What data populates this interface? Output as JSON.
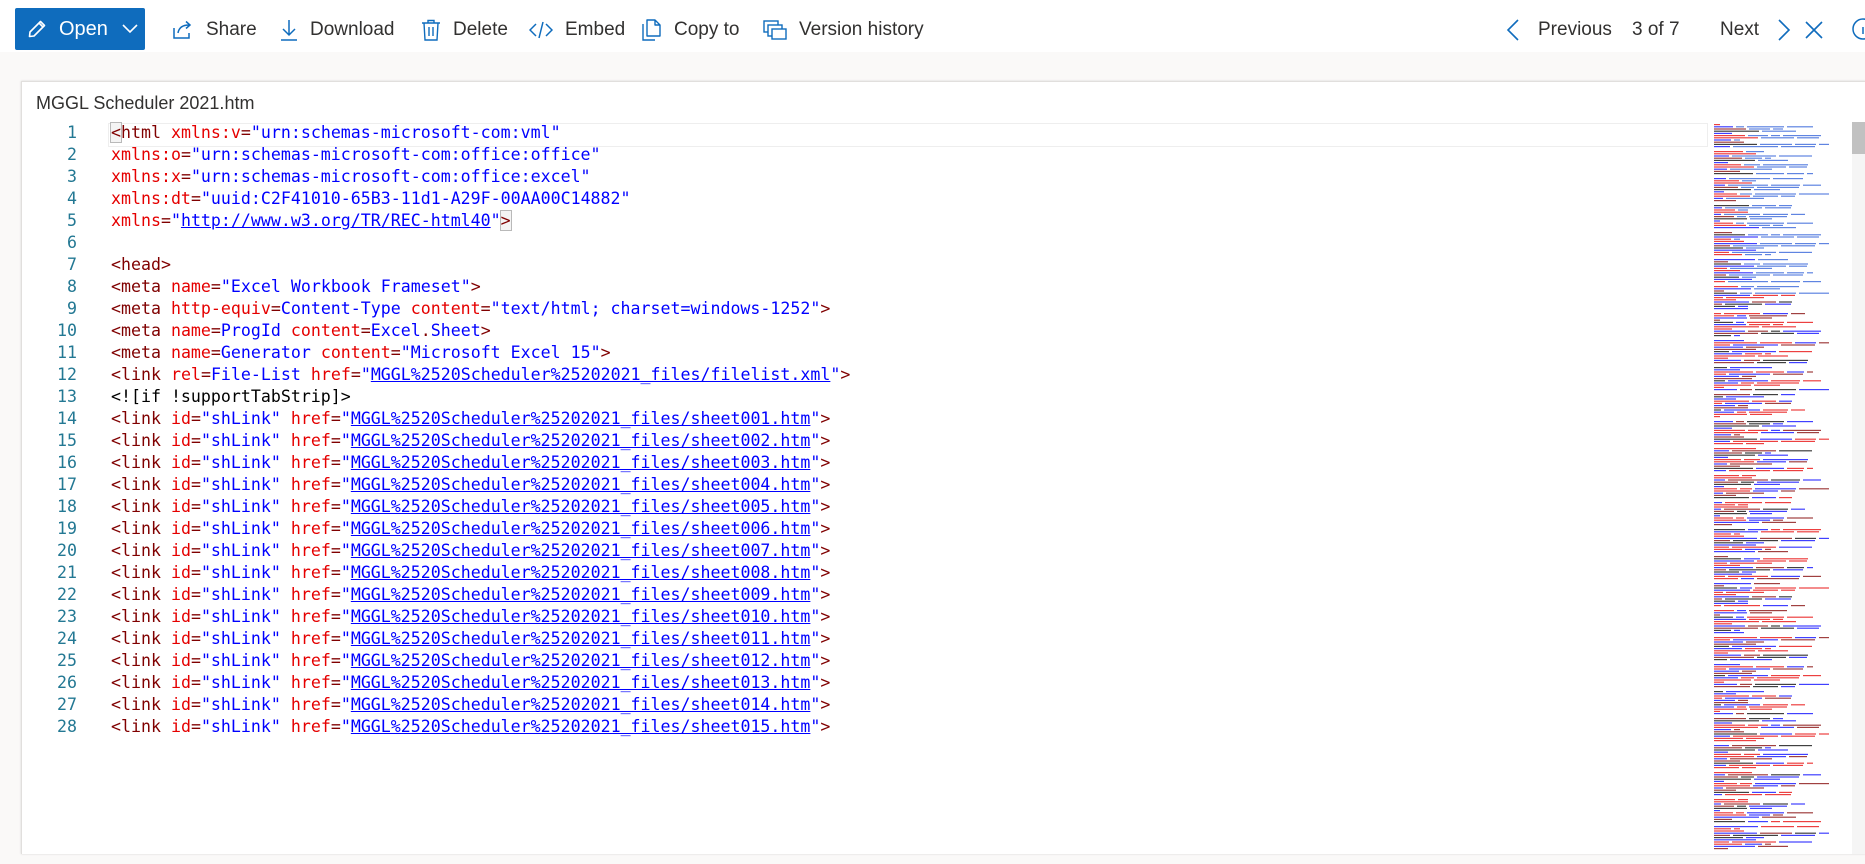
{
  "toolbar": {
    "open_label": "Open",
    "share_label": "Share",
    "download_label": "Download",
    "delete_label": "Delete",
    "embed_label": "Embed",
    "copyto_label": "Copy to",
    "version_label": "Version history",
    "previous_label": "Previous",
    "counter": "3 of 7",
    "next_label": "Next",
    "accent": "#0f6cbd",
    "icons": [
      "pencil-icon",
      "chevron-down-icon",
      "share-icon",
      "download-icon",
      "delete-icon",
      "embed-icon",
      "copy-icon",
      "version-history-icon",
      "chevron-left-icon",
      "chevron-right-icon",
      "close-icon",
      "info-icon"
    ]
  },
  "viewer": {
    "file_title": "MGGL Scheduler 2021.htm",
    "lines": [
      {
        "n": "1",
        "tokens": [
          [
            "h",
            "<"
          ],
          [
            "tag",
            "html "
          ],
          [
            "attr",
            "xmlns:v"
          ],
          [
            "tag",
            "="
          ],
          [
            "val",
            "\"urn:schemas-microsoft-com:vml\""
          ]
        ]
      },
      {
        "n": "2",
        "tokens": [
          [
            "attr",
            "xmlns:o"
          ],
          [
            "tag",
            "="
          ],
          [
            "val",
            "\"urn:schemas-microsoft-com:office:office\""
          ]
        ]
      },
      {
        "n": "3",
        "tokens": [
          [
            "attr",
            "xmlns:x"
          ],
          [
            "tag",
            "="
          ],
          [
            "val",
            "\"urn:schemas-microsoft-com:office:excel\""
          ]
        ]
      },
      {
        "n": "4",
        "tokens": [
          [
            "attr",
            "xmlns:dt"
          ],
          [
            "tag",
            "="
          ],
          [
            "val",
            "\"uuid:C2F41010-65B3-11d1-A29F-00AA00C14882\""
          ]
        ]
      },
      {
        "n": "5",
        "tokens": [
          [
            "attr",
            "xmlns"
          ],
          [
            "tag",
            "="
          ],
          [
            "val",
            "\""
          ],
          [
            "link",
            "http://www.w3.org/TR/REC-html40"
          ],
          [
            "val",
            "\""
          ],
          [
            "h",
            ">"
          ]
        ]
      },
      {
        "n": "6",
        "tokens": []
      },
      {
        "n": "7",
        "tokens": [
          [
            "tag",
            "<head>"
          ]
        ]
      },
      {
        "n": "8",
        "tokens": [
          [
            "tag",
            "<meta "
          ],
          [
            "attr",
            "name"
          ],
          [
            "tag",
            "="
          ],
          [
            "val",
            "\"Excel Workbook Frameset\""
          ],
          [
            "tag",
            ">"
          ]
        ]
      },
      {
        "n": "9",
        "tokens": [
          [
            "tag",
            "<meta "
          ],
          [
            "attr",
            "http-equiv"
          ],
          [
            "tag",
            "="
          ],
          [
            "val",
            "Content-Type "
          ],
          [
            "attr",
            "content"
          ],
          [
            "tag",
            "="
          ],
          [
            "val",
            "\"text/html; charset=windows-1252\""
          ],
          [
            "tag",
            ">"
          ]
        ]
      },
      {
        "n": "10",
        "tokens": [
          [
            "tag",
            "<meta "
          ],
          [
            "attr",
            "name"
          ],
          [
            "tag",
            "="
          ],
          [
            "val",
            "ProgId "
          ],
          [
            "attr",
            "content"
          ],
          [
            "tag",
            "="
          ],
          [
            "val",
            "Excel"
          ],
          [
            "tag",
            "."
          ],
          [
            "val",
            "Sheet"
          ],
          [
            "tag",
            ">"
          ]
        ]
      },
      {
        "n": "11",
        "tokens": [
          [
            "tag",
            "<meta "
          ],
          [
            "attr",
            "name"
          ],
          [
            "tag",
            "="
          ],
          [
            "val",
            "Generator "
          ],
          [
            "attr",
            "content"
          ],
          [
            "tag",
            "="
          ],
          [
            "val",
            "\"Microsoft Excel 15\""
          ],
          [
            "tag",
            ">"
          ]
        ]
      },
      {
        "n": "12",
        "tokens": [
          [
            "tag",
            "<link "
          ],
          [
            "attr",
            "rel"
          ],
          [
            "tag",
            "="
          ],
          [
            "val",
            "File-List "
          ],
          [
            "attr",
            "href"
          ],
          [
            "tag",
            "="
          ],
          [
            "val",
            "\""
          ],
          [
            "link",
            "MGGL%2520Scheduler%25202021_files/filelist.xml"
          ],
          [
            "val",
            "\""
          ],
          [
            "tag",
            ">"
          ]
        ]
      },
      {
        "n": "13",
        "tokens": [
          [
            "plain",
            "<![if !supportTabStrip]>"
          ]
        ]
      },
      {
        "n": "14",
        "tokens": [
          [
            "tag",
            "<link "
          ],
          [
            "attr",
            "id"
          ],
          [
            "tag",
            "="
          ],
          [
            "val",
            "\"shLink\" "
          ],
          [
            "attr",
            "href"
          ],
          [
            "tag",
            "="
          ],
          [
            "val",
            "\""
          ],
          [
            "link",
            "MGGL%2520Scheduler%25202021_files/sheet001.htm"
          ],
          [
            "val",
            "\""
          ],
          [
            "tag",
            ">"
          ]
        ]
      },
      {
        "n": "15",
        "tokens": [
          [
            "tag",
            "<link "
          ],
          [
            "attr",
            "id"
          ],
          [
            "tag",
            "="
          ],
          [
            "val",
            "\"shLink\" "
          ],
          [
            "attr",
            "href"
          ],
          [
            "tag",
            "="
          ],
          [
            "val",
            "\""
          ],
          [
            "link",
            "MGGL%2520Scheduler%25202021_files/sheet002.htm"
          ],
          [
            "val",
            "\""
          ],
          [
            "tag",
            ">"
          ]
        ]
      },
      {
        "n": "16",
        "tokens": [
          [
            "tag",
            "<link "
          ],
          [
            "attr",
            "id"
          ],
          [
            "tag",
            "="
          ],
          [
            "val",
            "\"shLink\" "
          ],
          [
            "attr",
            "href"
          ],
          [
            "tag",
            "="
          ],
          [
            "val",
            "\""
          ],
          [
            "link",
            "MGGL%2520Scheduler%25202021_files/sheet003.htm"
          ],
          [
            "val",
            "\""
          ],
          [
            "tag",
            ">"
          ]
        ]
      },
      {
        "n": "17",
        "tokens": [
          [
            "tag",
            "<link "
          ],
          [
            "attr",
            "id"
          ],
          [
            "tag",
            "="
          ],
          [
            "val",
            "\"shLink\" "
          ],
          [
            "attr",
            "href"
          ],
          [
            "tag",
            "="
          ],
          [
            "val",
            "\""
          ],
          [
            "link",
            "MGGL%2520Scheduler%25202021_files/sheet004.htm"
          ],
          [
            "val",
            "\""
          ],
          [
            "tag",
            ">"
          ]
        ]
      },
      {
        "n": "18",
        "tokens": [
          [
            "tag",
            "<link "
          ],
          [
            "attr",
            "id"
          ],
          [
            "tag",
            "="
          ],
          [
            "val",
            "\"shLink\" "
          ],
          [
            "attr",
            "href"
          ],
          [
            "tag",
            "="
          ],
          [
            "val",
            "\""
          ],
          [
            "link",
            "MGGL%2520Scheduler%25202021_files/sheet005.htm"
          ],
          [
            "val",
            "\""
          ],
          [
            "tag",
            ">"
          ]
        ]
      },
      {
        "n": "19",
        "tokens": [
          [
            "tag",
            "<link "
          ],
          [
            "attr",
            "id"
          ],
          [
            "tag",
            "="
          ],
          [
            "val",
            "\"shLink\" "
          ],
          [
            "attr",
            "href"
          ],
          [
            "tag",
            "="
          ],
          [
            "val",
            "\""
          ],
          [
            "link",
            "MGGL%2520Scheduler%25202021_files/sheet006.htm"
          ],
          [
            "val",
            "\""
          ],
          [
            "tag",
            ">"
          ]
        ]
      },
      {
        "n": "20",
        "tokens": [
          [
            "tag",
            "<link "
          ],
          [
            "attr",
            "id"
          ],
          [
            "tag",
            "="
          ],
          [
            "val",
            "\"shLink\" "
          ],
          [
            "attr",
            "href"
          ],
          [
            "tag",
            "="
          ],
          [
            "val",
            "\""
          ],
          [
            "link",
            "MGGL%2520Scheduler%25202021_files/sheet007.htm"
          ],
          [
            "val",
            "\""
          ],
          [
            "tag",
            ">"
          ]
        ]
      },
      {
        "n": "21",
        "tokens": [
          [
            "tag",
            "<link "
          ],
          [
            "attr",
            "id"
          ],
          [
            "tag",
            "="
          ],
          [
            "val",
            "\"shLink\" "
          ],
          [
            "attr",
            "href"
          ],
          [
            "tag",
            "="
          ],
          [
            "val",
            "\""
          ],
          [
            "link",
            "MGGL%2520Scheduler%25202021_files/sheet008.htm"
          ],
          [
            "val",
            "\""
          ],
          [
            "tag",
            ">"
          ]
        ]
      },
      {
        "n": "22",
        "tokens": [
          [
            "tag",
            "<link "
          ],
          [
            "attr",
            "id"
          ],
          [
            "tag",
            "="
          ],
          [
            "val",
            "\"shLink\" "
          ],
          [
            "attr",
            "href"
          ],
          [
            "tag",
            "="
          ],
          [
            "val",
            "\""
          ],
          [
            "link",
            "MGGL%2520Scheduler%25202021_files/sheet009.htm"
          ],
          [
            "val",
            "\""
          ],
          [
            "tag",
            ">"
          ]
        ]
      },
      {
        "n": "23",
        "tokens": [
          [
            "tag",
            "<link "
          ],
          [
            "attr",
            "id"
          ],
          [
            "tag",
            "="
          ],
          [
            "val",
            "\"shLink\" "
          ],
          [
            "attr",
            "href"
          ],
          [
            "tag",
            "="
          ],
          [
            "val",
            "\""
          ],
          [
            "link",
            "MGGL%2520Scheduler%25202021_files/sheet010.htm"
          ],
          [
            "val",
            "\""
          ],
          [
            "tag",
            ">"
          ]
        ]
      },
      {
        "n": "24",
        "tokens": [
          [
            "tag",
            "<link "
          ],
          [
            "attr",
            "id"
          ],
          [
            "tag",
            "="
          ],
          [
            "val",
            "\"shLink\" "
          ],
          [
            "attr",
            "href"
          ],
          [
            "tag",
            "="
          ],
          [
            "val",
            "\""
          ],
          [
            "link",
            "MGGL%2520Scheduler%25202021_files/sheet011.htm"
          ],
          [
            "val",
            "\""
          ],
          [
            "tag",
            ">"
          ]
        ]
      },
      {
        "n": "25",
        "tokens": [
          [
            "tag",
            "<link "
          ],
          [
            "attr",
            "id"
          ],
          [
            "tag",
            "="
          ],
          [
            "val",
            "\"shLink\" "
          ],
          [
            "attr",
            "href"
          ],
          [
            "tag",
            "="
          ],
          [
            "val",
            "\""
          ],
          [
            "link",
            "MGGL%2520Scheduler%25202021_files/sheet012.htm"
          ],
          [
            "val",
            "\""
          ],
          [
            "tag",
            ">"
          ]
        ]
      },
      {
        "n": "26",
        "tokens": [
          [
            "tag",
            "<link "
          ],
          [
            "attr",
            "id"
          ],
          [
            "tag",
            "="
          ],
          [
            "val",
            "\"shLink\" "
          ],
          [
            "attr",
            "href"
          ],
          [
            "tag",
            "="
          ],
          [
            "val",
            "\""
          ],
          [
            "link",
            "MGGL%2520Scheduler%25202021_files/sheet013.htm"
          ],
          [
            "val",
            "\""
          ],
          [
            "tag",
            ">"
          ]
        ]
      },
      {
        "n": "27",
        "tokens": [
          [
            "tag",
            "<link "
          ],
          [
            "attr",
            "id"
          ],
          [
            "tag",
            "="
          ],
          [
            "val",
            "\"shLink\" "
          ],
          [
            "attr",
            "href"
          ],
          [
            "tag",
            "="
          ],
          [
            "val",
            "\""
          ],
          [
            "link",
            "MGGL%2520Scheduler%25202021_files/sheet014.htm"
          ],
          [
            "val",
            "\""
          ],
          [
            "tag",
            ">"
          ]
        ]
      },
      {
        "n": "28",
        "tokens": [
          [
            "tag",
            "<link "
          ],
          [
            "attr",
            "id"
          ],
          [
            "tag",
            "="
          ],
          [
            "val",
            "\"shLink\" "
          ],
          [
            "attr",
            "href"
          ],
          [
            "tag",
            "="
          ],
          [
            "val",
            "\""
          ],
          [
            "link",
            "MGGL%2520Scheduler%25202021_files/sheet015.htm"
          ],
          [
            "val",
            "\""
          ],
          [
            "tag",
            ">"
          ]
        ]
      }
    ]
  }
}
